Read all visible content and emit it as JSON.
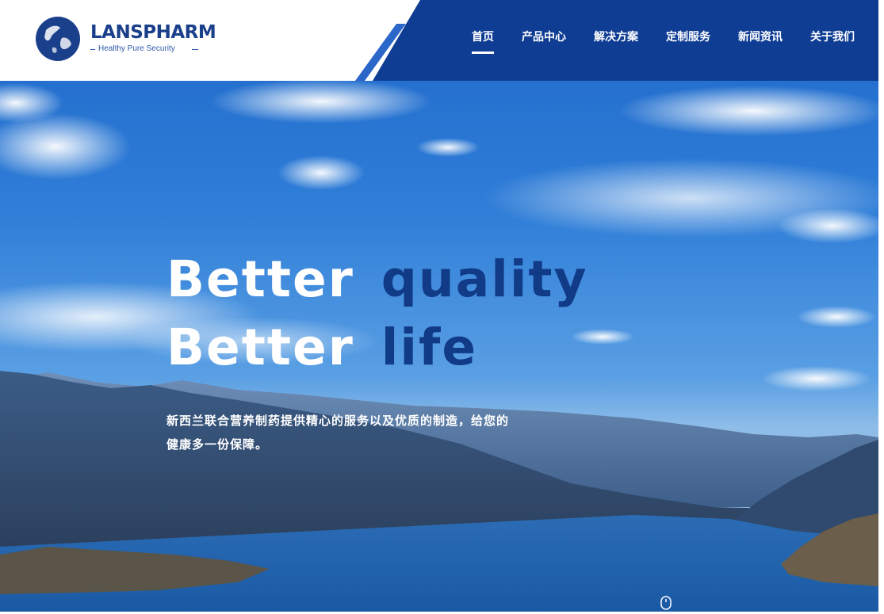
{
  "brand": {
    "name": "LANSPHARM",
    "tagline": "Healthy Pure Security",
    "colors": {
      "primary": "#113a87",
      "nav": "#0f3d94",
      "sky": "#2d78d5",
      "white": "#ffffff"
    }
  },
  "nav": {
    "items": [
      {
        "label": "首页",
        "active": true
      },
      {
        "label": "产品中心",
        "active": false
      },
      {
        "label": "解决方案",
        "active": false
      },
      {
        "label": "定制服务",
        "active": false
      },
      {
        "label": "新闻资讯",
        "active": false
      },
      {
        "label": "关于我们",
        "active": false
      }
    ]
  },
  "hero": {
    "line1_white": "Better",
    "line1_blue": "quality",
    "line2_white": "Better",
    "line2_blue": "life",
    "description": "新西兰联合营养制药提供精心的服务以及优质的制造，给您的健康多一份保障。"
  },
  "icons": {
    "logo": "globe-logo-icon",
    "scroll": "scroll-down-icon"
  }
}
